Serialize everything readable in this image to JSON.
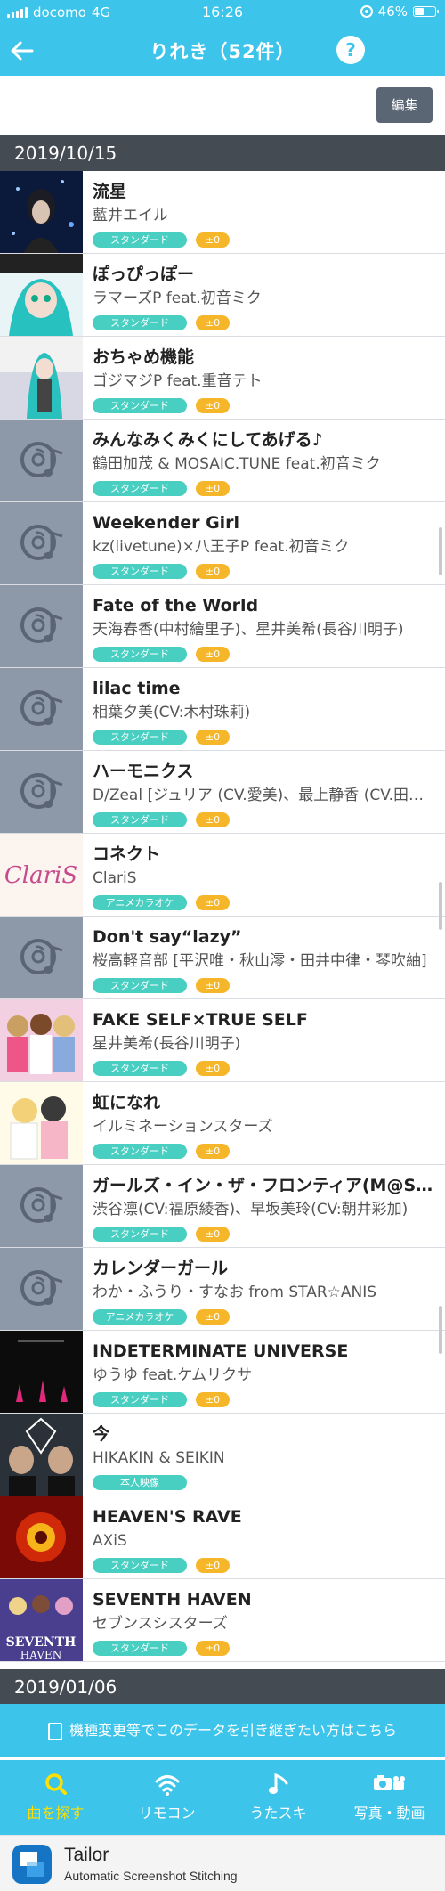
{
  "status_bar": {
    "carrier": "docomo",
    "network": "4G",
    "time": "16:26",
    "battery": "46%",
    "battery_level": 0.46
  },
  "header": {
    "title": "りれき（52件）",
    "help": "?"
  },
  "toolbar": {
    "edit_label": "編集"
  },
  "sections": [
    {
      "date": "2019/10/15"
    },
    {
      "date": "2019/01/06"
    }
  ],
  "songs": [
    {
      "title": "流星",
      "artist": "藍井エイル",
      "type": "スタンダード",
      "score": "±0",
      "thumb": "photo-dark-blue"
    },
    {
      "title": "ぽっぴっぽー",
      "artist": "ラマーズP feat.初音ミク",
      "type": "スタンダード",
      "score": "±0",
      "thumb": "teal-character"
    },
    {
      "title": "おちゃめ機能",
      "artist": "ゴジマジP feat.重音テト",
      "type": "スタンダード",
      "score": "±0",
      "thumb": "teal-character-2"
    },
    {
      "title": "みんなみくみくにしてあげる♪",
      "artist": "鶴田加茂 & MOSAIC.TUNE feat.初音ミク",
      "type": "スタンダード",
      "score": "±0",
      "thumb": "placeholder"
    },
    {
      "title": "Weekender Girl",
      "artist": "kz(livetune)×八王子P feat.初音ミク",
      "type": "スタンダード",
      "score": "±0",
      "thumb": "placeholder"
    },
    {
      "title": "Fate of the World",
      "artist": "天海春香(中村繪里子)、星井美希(長谷川明子)",
      "type": "スタンダード",
      "score": "±0",
      "thumb": "placeholder"
    },
    {
      "title": "lilac time",
      "artist": "相葉夕美(CV:木村珠莉)",
      "type": "スタンダード",
      "score": "±0",
      "thumb": "placeholder"
    },
    {
      "title": "ハーモニクス",
      "artist": "D/Zeal [ジュリア (CV.愛美)、最上静香 (CV.田所あずさ)]",
      "type": "スタンダード",
      "score": "±0",
      "thumb": "placeholder"
    },
    {
      "title": "コネクト",
      "artist": "ClariS",
      "type": "アニメカラオケ",
      "score": "±0",
      "thumb": "claris"
    },
    {
      "title": "Don't say“lazy”",
      "artist": "桜高軽音部 [平沢唯・秋山澪・田井中律・琴吹紬]",
      "type": "スタンダード",
      "score": "±0",
      "thumb": "placeholder"
    },
    {
      "title": "FAKE SELF×TRUE SELF",
      "artist": "星井美希(長谷川明子)",
      "type": "スタンダード",
      "score": "±0",
      "thumb": "anime-group"
    },
    {
      "title": "虹になれ",
      "artist": "イルミネーションスターズ",
      "type": "スタンダード",
      "score": "±0",
      "thumb": "anime-group-2"
    },
    {
      "title": "ガールズ・イン・ザ・フロンティア(M@STER VERSION)",
      "artist": "渋谷凛(CV:福原綾香)、早坂美玲(CV:朝井彩加)",
      "type": "スタンダード",
      "score": "±0",
      "thumb": "placeholder"
    },
    {
      "title": "カレンダーガール",
      "artist": "わか・ふうり・すなお from STAR☆ANIS",
      "type": "アニメカラオケ",
      "score": "±0",
      "thumb": "placeholder"
    },
    {
      "title": "INDETERMINATE UNIVERSE",
      "artist": "ゆうゆ feat.ケムリクサ",
      "type": "スタンダード",
      "score": "±0",
      "thumb": "black-red"
    },
    {
      "title": "今",
      "artist": "HIKAKIN & SEIKIN",
      "type": "本人映像",
      "score": "",
      "thumb": "duo-photo"
    },
    {
      "title": "HEAVEN'S RAVE",
      "artist": "AXiS",
      "type": "スタンダード",
      "score": "±0",
      "thumb": "red-fire"
    },
    {
      "title": "SEVENTH HAVEN",
      "artist": "セブンスシスターズ",
      "type": "スタンダード",
      "score": "±0",
      "thumb": "seventh"
    }
  ],
  "transfer_banner": {
    "label": "機種変更等でこのデータを引き継ぎたい方はこちら"
  },
  "tabs": [
    {
      "label": "曲を探す",
      "icon": "search-icon",
      "active": true
    },
    {
      "label": "リモコン",
      "icon": "wifi-icon",
      "active": false
    },
    {
      "label": "うたスキ",
      "icon": "music-note-icon",
      "active": false
    },
    {
      "label": "写真・動画",
      "icon": "camera-icon",
      "active": false
    }
  ],
  "tailor": {
    "name": "Tailor",
    "subtitle": "Automatic Screenshot Stitching"
  },
  "colors": {
    "header": "#3cc4ea",
    "section": "#454b52",
    "badge_type": "#49cfc2",
    "badge_score": "#f5b62a",
    "active_tab": "#ffe000"
  }
}
